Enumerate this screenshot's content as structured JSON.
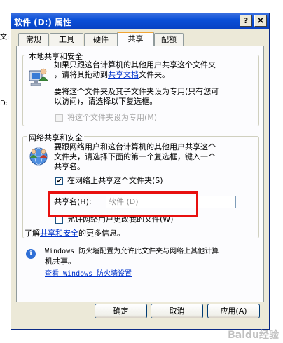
{
  "background": {
    "left_fragment_1": "文:",
    "left_fragment_2": "D:"
  },
  "window": {
    "title": "软件 (D:) 属性",
    "help_button": "?",
    "close_button": "×"
  },
  "tabs": [
    {
      "label": "常规"
    },
    {
      "label": "工具"
    },
    {
      "label": "硬件"
    },
    {
      "label": "共享"
    },
    {
      "label": "配额"
    }
  ],
  "local_group": {
    "title": "本地共享和安全",
    "line1": "如果只跟这台计算机的其他用户共享这个文件夹",
    "line2_prefix": "，请将其拖动到",
    "line2_link": "共享文档",
    "line2_suffix": "文件夹。",
    "line3": "要将这个文件夹及其子文件夹设为专用(只有您可",
    "line4": "以访问)，请选择以下复选框。",
    "private_checkbox_label": "将这个文件夹设为专用(M)"
  },
  "network_group": {
    "title": "网络共享和安全",
    "line1": "要跟网络用户和这台计算机的其他用户共享这个",
    "line2": "文件夹，请选择下面的第一个复选框，键入一个",
    "line3": "共享名。",
    "share_checkbox_label": "在网络上共享这个文件夹(S)",
    "share_checkbox_mark": "✔",
    "share_name_label": "共享名(H):",
    "share_name_value": "软件 (D)",
    "allow_change_label": "允许网络用户更改我的文件(W)",
    "learn_prefix": "了解",
    "learn_link": "共享和安全",
    "learn_suffix": "的更多信息。"
  },
  "firewall": {
    "info_icon_glyph": "i",
    "line1": "Windows 防火墙配置为允许此文件夹与网络上其他计算",
    "line2": "机共享。",
    "settings_link": "查看 Windows 防火墙设置"
  },
  "buttons": {
    "ok": "确定",
    "cancel": "取消",
    "apply": "应用(A)"
  },
  "watermark": "Baidu经验",
  "colors": {
    "titlebar": "#0a50d8",
    "link": "#0033cc",
    "highlight_box": "#e8100f"
  }
}
